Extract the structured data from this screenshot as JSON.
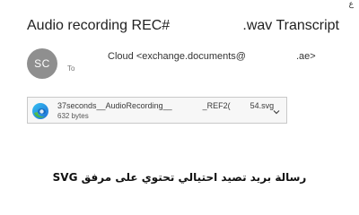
{
  "corner_mark": "ع",
  "email": {
    "subject_left": "Audio recording REC#",
    "subject_right": ".wav Transcript",
    "avatar_initials": "SC",
    "sender_name": "Cloud",
    "sender_email_prefix": "<exchange.documents@",
    "sender_email_suffix": ".ae>",
    "to_label": "To"
  },
  "attachment": {
    "name_part1": "37seconds__AudioRecording__",
    "name_part2": "_REF2(",
    "name_part3": "54.svg",
    "size": "632 bytes",
    "icon": "edge-browser-icon"
  },
  "caption": "رسالة بريد تصيد احتيالي تحتوي على مرفق SVG",
  "colors": {
    "avatar_bg": "#8f8f8f",
    "attachment_bg": "#f7f7f7",
    "attachment_border": "#c9c9c9"
  }
}
